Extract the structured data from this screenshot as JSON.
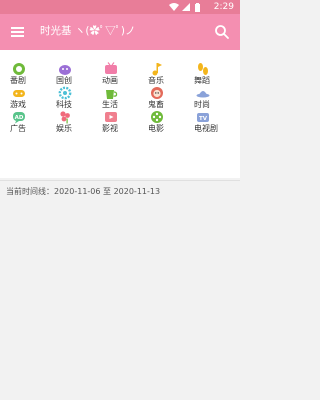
{
  "status_bar": {
    "time": "2:29",
    "icons": [
      "wifi-icon",
      "signal-icon",
      "battery-icon"
    ]
  },
  "toolbar": {
    "title": "时光基 ヽ(✿ﾟ▽ﾟ)ノ",
    "menu_icon": "menu-icon",
    "search_icon": "search-icon"
  },
  "colors": {
    "toolbar": "#f48fb1",
    "status_bar": "#e87d98"
  },
  "categories": [
    {
      "label": "番剧",
      "icon": "bangumi-icon",
      "color": "#6fba3a"
    },
    {
      "label": "国创",
      "icon": "guochuang-icon",
      "color": "#9b6fd6"
    },
    {
      "label": "动画",
      "icon": "tv-icon",
      "color": "#f17da8"
    },
    {
      "label": "音乐",
      "icon": "music-note-icon",
      "color": "#f3b51c"
    },
    {
      "label": "舞蹈",
      "icon": "footprints-icon",
      "color": "#f3b51c"
    },
    {
      "label": "游戏",
      "icon": "gamepad-icon",
      "color": "#f3b51c"
    },
    {
      "label": "科技",
      "icon": "gear-icon",
      "color": "#4cc0d6"
    },
    {
      "label": "生活",
      "icon": "cup-icon",
      "color": "#6fba3a"
    },
    {
      "label": "鬼畜",
      "icon": "face-icon",
      "color": "#e36a5a"
    },
    {
      "label": "时尚",
      "icon": "hat-icon",
      "color": "#8aa2d9"
    },
    {
      "label": "广告",
      "icon": "ad-icon",
      "color": "#58c48a"
    },
    {
      "label": "娱乐",
      "icon": "flower-icon",
      "color": "#f06a7b"
    },
    {
      "label": "影视",
      "icon": "film-icon",
      "color": "#f07f8e"
    },
    {
      "label": "电影",
      "icon": "film-reel-icon",
      "color": "#6fba3a"
    },
    {
      "label": "电视剧",
      "icon": "tv-show-icon",
      "color": "#8aa2d9"
    }
  ],
  "timeline": "当前时间线：2020-11-06 至 2020-11-13"
}
